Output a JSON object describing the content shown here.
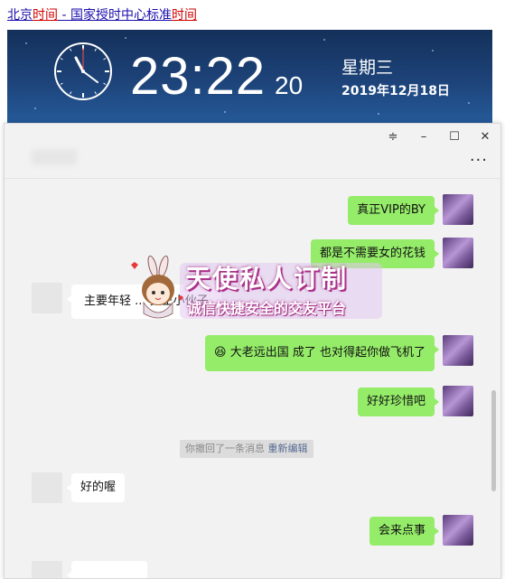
{
  "link_bar": {
    "part1": "北京",
    "part2": "时间",
    "part3": " - 国家授时中心标准",
    "part4": "时间"
  },
  "clock": {
    "time": "23:22",
    "seconds": "20",
    "weekday": "星期三",
    "date": "2019年12月18日"
  },
  "window_controls": {
    "pin": "≑",
    "minimize": "–",
    "maximize": "☐",
    "close": "✕",
    "more": "···"
  },
  "messages": [
    {
      "side": "mine",
      "text": "真正VIP的BY"
    },
    {
      "side": "mine",
      "text": "都是不需要女的花钱"
    },
    {
      "side": "theirs",
      "text": "主要年轻 ... 真正小伙子"
    },
    {
      "side": "mine",
      "emoji": "😆",
      "text": "大老远出国  成了 也对得起你做飞机了"
    },
    {
      "side": "mine",
      "text": "好好珍惜吧"
    },
    {
      "side": "theirs",
      "text": "好的喔"
    },
    {
      "side": "mine",
      "text": "会来点事"
    }
  ],
  "system_notice": {
    "text": "你撤回了一条消息 ",
    "action": "重新编辑"
  },
  "ad_overlay": {
    "title": "天使私人订制",
    "subtitle": "诚信快捷安全的交友平台"
  },
  "colors": {
    "mine_bubble": "#95ec69",
    "theirs_bubble": "#ffffff",
    "chat_bg": "#f2f2f2",
    "link_blue": "#1a0dab",
    "link_red": "#d10000"
  }
}
